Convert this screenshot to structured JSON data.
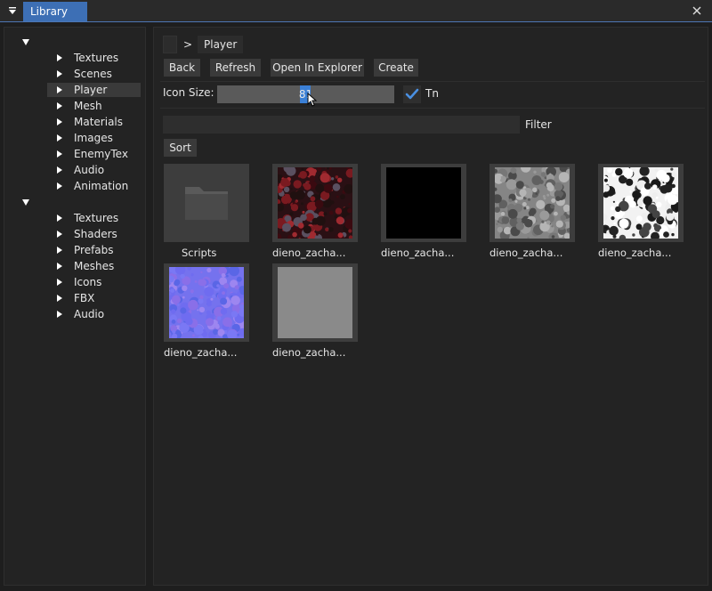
{
  "window": {
    "tab_label": "Library",
    "menu_icon": "triangle-down-icon",
    "close_icon": "close-icon"
  },
  "tree": {
    "groups": [
      {
        "expanded": true,
        "items": [
          "Textures",
          "Scenes",
          "Player",
          "Mesh",
          "Materials",
          "Images",
          "EnemyTex",
          "Audio",
          "Animation"
        ]
      },
      {
        "expanded": true,
        "items": [
          "Textures",
          "Shaders",
          "Prefabs",
          "Meshes",
          "Icons",
          "FBX",
          "Audio"
        ]
      }
    ],
    "selected": "Player"
  },
  "breadcrumb": {
    "separator": ">",
    "current": "Player"
  },
  "toolbar": {
    "back": "Back",
    "refresh": "Refresh",
    "open_in_explorer": "Open In Explorer",
    "create": "Create"
  },
  "icon_size": {
    "label": "Icon Size:",
    "value": "81",
    "checkbox_checked": true,
    "checkbox_label": "Tn"
  },
  "filter": {
    "value": "",
    "label": "Filter"
  },
  "sort_label": "Sort",
  "files": [
    {
      "name": "Scripts",
      "kind": "folder"
    },
    {
      "name": "dieno_zacha...",
      "kind": "texture-red"
    },
    {
      "name": "dieno_zacha...",
      "kind": "texture-black"
    },
    {
      "name": "dieno_zacha...",
      "kind": "texture-gray"
    },
    {
      "name": "dieno_zacha...",
      "kind": "texture-white"
    },
    {
      "name": "dieno_zacha...",
      "kind": "texture-purple"
    },
    {
      "name": "dieno_zacha...",
      "kind": "texture-flatgray"
    }
  ],
  "colors": {
    "accent": "#3d6fb5",
    "slider_grab": "#3b80d6",
    "checkmark": "#4a90e2"
  }
}
